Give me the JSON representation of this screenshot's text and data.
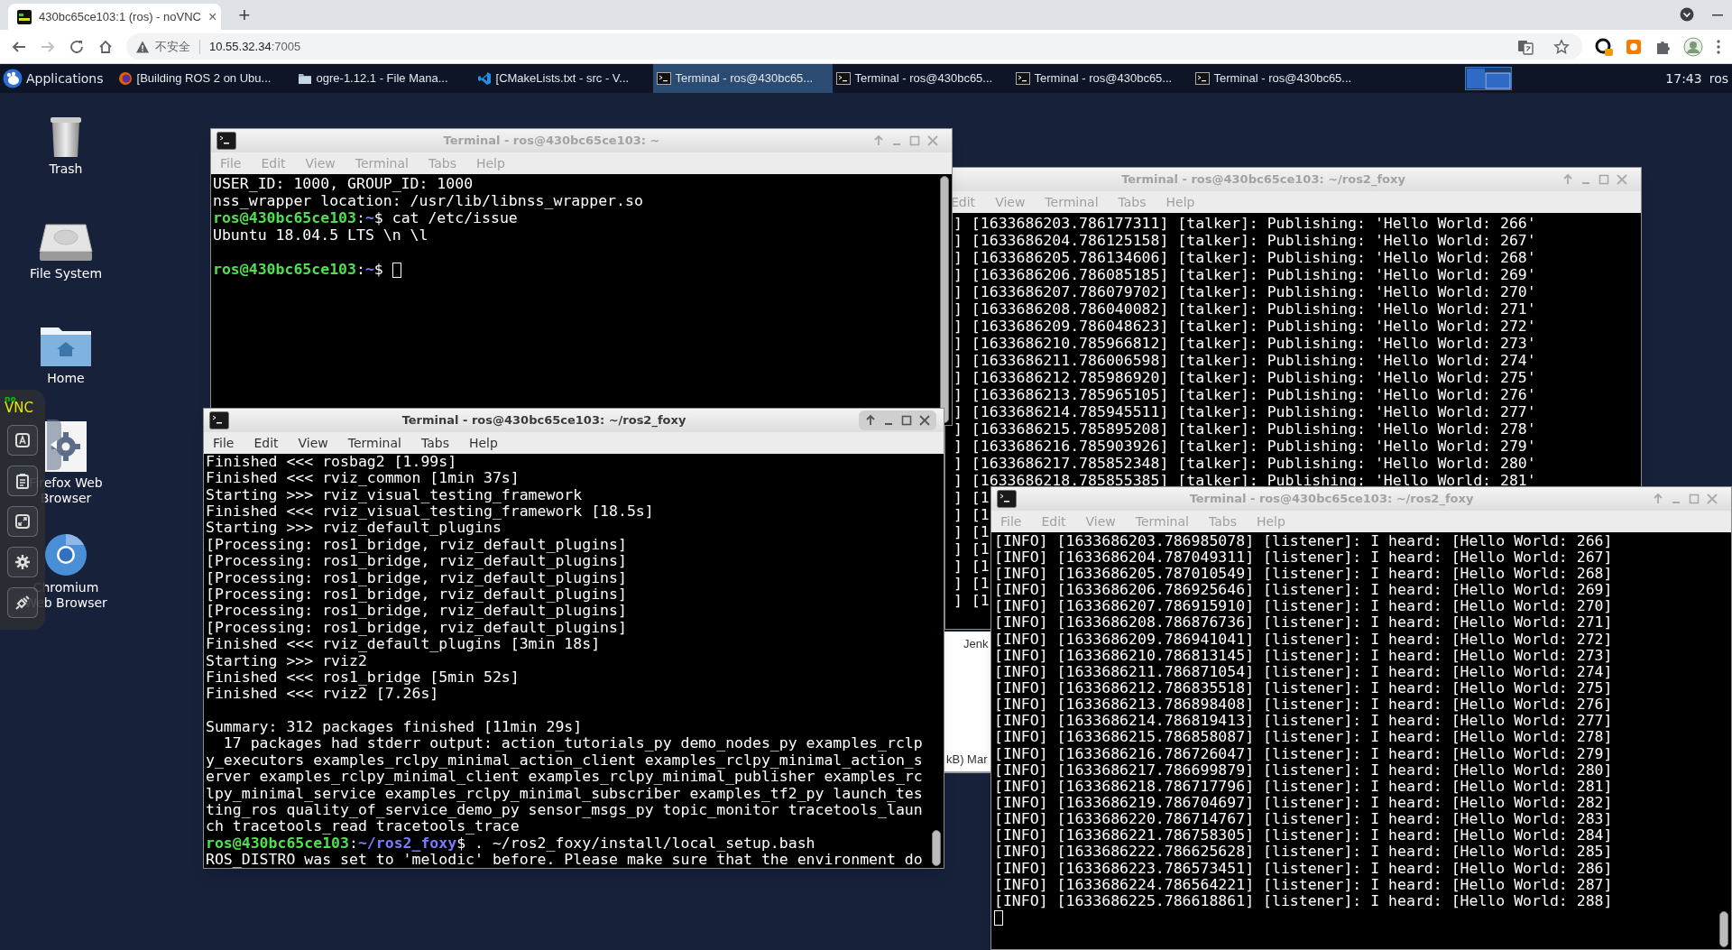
{
  "browser": {
    "tab": {
      "title": "430bc65ce103:1 (ros) - noVNC",
      "close": "×"
    },
    "new_tab": "+",
    "address": {
      "security": "不安全",
      "host": "10.55.32.34",
      "port": ":7005"
    }
  },
  "taskbar": {
    "menu": "Applications",
    "items": [
      {
        "label": "[Building ROS 2 on Ubu...",
        "kind": "browser",
        "selected": false
      },
      {
        "label": "ogre-1.12.1 - File Mana...",
        "kind": "files",
        "selected": false
      },
      {
        "label": "[CMakeLists.txt - src - V...",
        "kind": "editor",
        "selected": false
      },
      {
        "label": "Terminal - ros@430bc65...",
        "kind": "terminal",
        "selected": true
      },
      {
        "label": "Terminal - ros@430bc65...",
        "kind": "terminal",
        "selected": false
      },
      {
        "label": "Terminal - ros@430bc65...",
        "kind": "terminal",
        "selected": false
      },
      {
        "label": "Terminal - ros@430bc65...",
        "kind": "terminal",
        "selected": false
      }
    ],
    "clock": "17:43",
    "user": "ros"
  },
  "desktop_icons": [
    {
      "label": "Trash",
      "kind": "trash"
    },
    {
      "label": "File System",
      "kind": "drive"
    },
    {
      "label": "Home",
      "kind": "home"
    },
    {
      "label": "Firefox Web Browser",
      "kind": "settings"
    },
    {
      "label": "Chromium Web Browser",
      "kind": "chromium"
    }
  ],
  "vnc_panel": {
    "logo_prefix": "no",
    "logo": "VNC"
  },
  "windows": [
    {
      "kind": "terminal",
      "title": "Terminal - ros@430bc65ce103: ~/ros2_foxy",
      "active": false,
      "menu": [
        "Edit",
        "View",
        "Terminal",
        "Tabs",
        "Help"
      ],
      "lines": [
        {
          "text": "] [1633686203.786177311] [talker]: Publishing: 'Hello World: 266'"
        },
        {
          "text": "] [1633686204.786125158] [talker]: Publishing: 'Hello World: 267'"
        },
        {
          "text": "] [1633686205.786134606] [talker]: Publishing: 'Hello World: 268'"
        },
        {
          "text": "] [1633686206.786085185] [talker]: Publishing: 'Hello World: 269'"
        },
        {
          "text": "] [1633686207.786079702] [talker]: Publishing: 'Hello World: 270'"
        },
        {
          "text": "] [1633686208.786040082] [talker]: Publishing: 'Hello World: 271'"
        },
        {
          "text": "] [1633686209.786048623] [talker]: Publishing: 'Hello World: 272'"
        },
        {
          "text": "] [1633686210.785966812] [talker]: Publishing: 'Hello World: 273'"
        },
        {
          "text": "] [1633686211.786006598] [talker]: Publishing: 'Hello World: 274'"
        },
        {
          "text": "] [1633686212.785986920] [talker]: Publishing: 'Hello World: 275'"
        },
        {
          "text": "] [1633686213.785965105] [talker]: Publishing: 'Hello World: 276'"
        },
        {
          "text": "] [1633686214.785945511] [talker]: Publishing: 'Hello World: 277'"
        },
        {
          "text": "] [1633686215.785895208] [talker]: Publishing: 'Hello World: 278'"
        },
        {
          "text": "] [1633686216.785903926] [talker]: Publishing: 'Hello World: 279'"
        },
        {
          "text": "] [1633686217.785852348] [talker]: Publishing: 'Hello World: 280'"
        },
        {
          "text": "] [1633686218.785855385] [talker]: Publishing: 'Hello World: 281'"
        },
        {
          "text": "] [1"
        },
        {
          "text": "] [1"
        },
        {
          "text": "] [1"
        },
        {
          "text": "] [1"
        },
        {
          "text": "] [1"
        },
        {
          "text": "] [1"
        },
        {
          "text": "] [1"
        }
      ]
    },
    {
      "kind": "background",
      "texts": [
        "Jenk",
        "kB) Mar"
      ]
    },
    {
      "kind": "terminal",
      "title": "Terminal - ros@430bc65ce103: ~",
      "active": false,
      "menu": [
        "File",
        "Edit",
        "View",
        "Terminal",
        "Tabs",
        "Help"
      ],
      "lines": [
        {
          "text": "USER_ID: 1000, GROUP_ID: 1000"
        },
        {
          "text": "nss_wrapper location: /usr/lib/libnss_wrapper.so"
        },
        {
          "kind": "prompt",
          "user": "ros@430bc65ce103",
          "sep": ":",
          "path": "~",
          "command": "$ cat /etc/issue"
        },
        {
          "text": "Ubuntu 18.04.5 LTS \\n \\l"
        },
        {
          "kind": "blank"
        },
        {
          "kind": "prompt",
          "user": "ros@430bc65ce103",
          "sep": ":",
          "path": "~",
          "command": "$ ",
          "cursor": true
        }
      ]
    },
    {
      "kind": "terminal",
      "title": "Terminal - ros@430bc65ce103: ~/ros2_foxy",
      "active": true,
      "menu": [
        "File",
        "Edit",
        "View",
        "Terminal",
        "Tabs",
        "Help"
      ],
      "lines": [
        {
          "text": "Finished <<< rosbag2 [1.99s]"
        },
        {
          "text": "Finished <<< rviz_common [1min 37s]"
        },
        {
          "text": "Starting >>> rviz_visual_testing_framework"
        },
        {
          "text": "Finished <<< rviz_visual_testing_framework [18.5s]"
        },
        {
          "text": "Starting >>> rviz_default_plugins"
        },
        {
          "text": "[Processing: ros1_bridge, rviz_default_plugins]"
        },
        {
          "text": "[Processing: ros1_bridge, rviz_default_plugins]"
        },
        {
          "text": "[Processing: ros1_bridge, rviz_default_plugins]"
        },
        {
          "text": "[Processing: ros1_bridge, rviz_default_plugins]"
        },
        {
          "text": "[Processing: ros1_bridge, rviz_default_plugins]"
        },
        {
          "text": "[Processing: ros1_bridge, rviz_default_plugins]"
        },
        {
          "text": "Finished <<< rviz_default_plugins [3min 18s]"
        },
        {
          "text": "Starting >>> rviz2"
        },
        {
          "text": "Finished <<< ros1_bridge [5min 52s]"
        },
        {
          "text": "Finished <<< rviz2 [7.26s]"
        },
        {
          "kind": "blank"
        },
        {
          "text": "Summary: 312 packages finished [11min 29s]"
        },
        {
          "text": "  17 packages had stderr output: action_tutorials_py demo_nodes_py examples_rclp"
        },
        {
          "text": "y_executors examples_rclpy_minimal_action_client examples_rclpy_minimal_action_s"
        },
        {
          "text": "erver examples_rclpy_minimal_client examples_rclpy_minimal_publisher examples_rc"
        },
        {
          "text": "lpy_minimal_service examples_rclpy_minimal_subscriber examples_tf2_py launch_tes"
        },
        {
          "text": "ting_ros quality_of_service_demo_py sensor_msgs_py topic_monitor tracetools_laun"
        },
        {
          "text": "ch tracetools_read tracetools_trace"
        },
        {
          "kind": "prompt",
          "user": "ros@430bc65ce103",
          "sep": ":",
          "path": "~/ros2_foxy",
          "command": "$ . ~/ros2_foxy/install/local_setup.bash"
        },
        {
          "text": "ROS_DISTRO was set to 'melodic' before. Please make sure that the environment do"
        }
      ]
    },
    {
      "kind": "terminal",
      "title": "Terminal - ros@430bc65ce103: ~/ros2_foxy",
      "active": false,
      "menu": [
        "File",
        "Edit",
        "View",
        "Terminal",
        "Tabs",
        "Help"
      ],
      "lines": [
        {
          "text": "[INFO] [1633686203.786985078] [listener]: I heard: [Hello World: 266]"
        },
        {
          "text": "[INFO] [1633686204.787049311] [listener]: I heard: [Hello World: 267]"
        },
        {
          "text": "[INFO] [1633686205.787010549] [listener]: I heard: [Hello World: 268]"
        },
        {
          "text": "[INFO] [1633686206.786925646] [listener]: I heard: [Hello World: 269]"
        },
        {
          "text": "[INFO] [1633686207.786915910] [listener]: I heard: [Hello World: 270]"
        },
        {
          "text": "[INFO] [1633686208.786876736] [listener]: I heard: [Hello World: 271]"
        },
        {
          "text": "[INFO] [1633686209.786941041] [listener]: I heard: [Hello World: 272]"
        },
        {
          "text": "[INFO] [1633686210.786813145] [listener]: I heard: [Hello World: 273]"
        },
        {
          "text": "[INFO] [1633686211.786871054] [listener]: I heard: [Hello World: 274]"
        },
        {
          "text": "[INFO] [1633686212.786835518] [listener]: I heard: [Hello World: 275]"
        },
        {
          "text": "[INFO] [1633686213.786898408] [listener]: I heard: [Hello World: 276]"
        },
        {
          "text": "[INFO] [1633686214.786819413] [listener]: I heard: [Hello World: 277]"
        },
        {
          "text": "[INFO] [1633686215.786858087] [listener]: I heard: [Hello World: 278]"
        },
        {
          "text": "[INFO] [1633686216.786726047] [listener]: I heard: [Hello World: 279]"
        },
        {
          "text": "[INFO] [1633686217.786699879] [listener]: I heard: [Hello World: 280]"
        },
        {
          "text": "[INFO] [1633686218.786717796] [listener]: I heard: [Hello World: 281]"
        },
        {
          "text": "[INFO] [1633686219.786704697] [listener]: I heard: [Hello World: 282]"
        },
        {
          "text": "[INFO] [1633686220.786714767] [listener]: I heard: [Hello World: 283]"
        },
        {
          "text": "[INFO] [1633686221.786758305] [listener]: I heard: [Hello World: 284]"
        },
        {
          "text": "[INFO] [1633686222.786625628] [listener]: I heard: [Hello World: 285]"
        },
        {
          "text": "[INFO] [1633686223.786573451] [listener]: I heard: [Hello World: 286]"
        },
        {
          "text": "[INFO] [1633686224.786564221] [listener]: I heard: [Hello World: 287]"
        },
        {
          "text": "[INFO] [1633686225.786618861] [listener]: I heard: [Hello World: 288]"
        },
        {
          "kind": "cursor_line",
          "cursor": true
        }
      ]
    }
  ]
}
